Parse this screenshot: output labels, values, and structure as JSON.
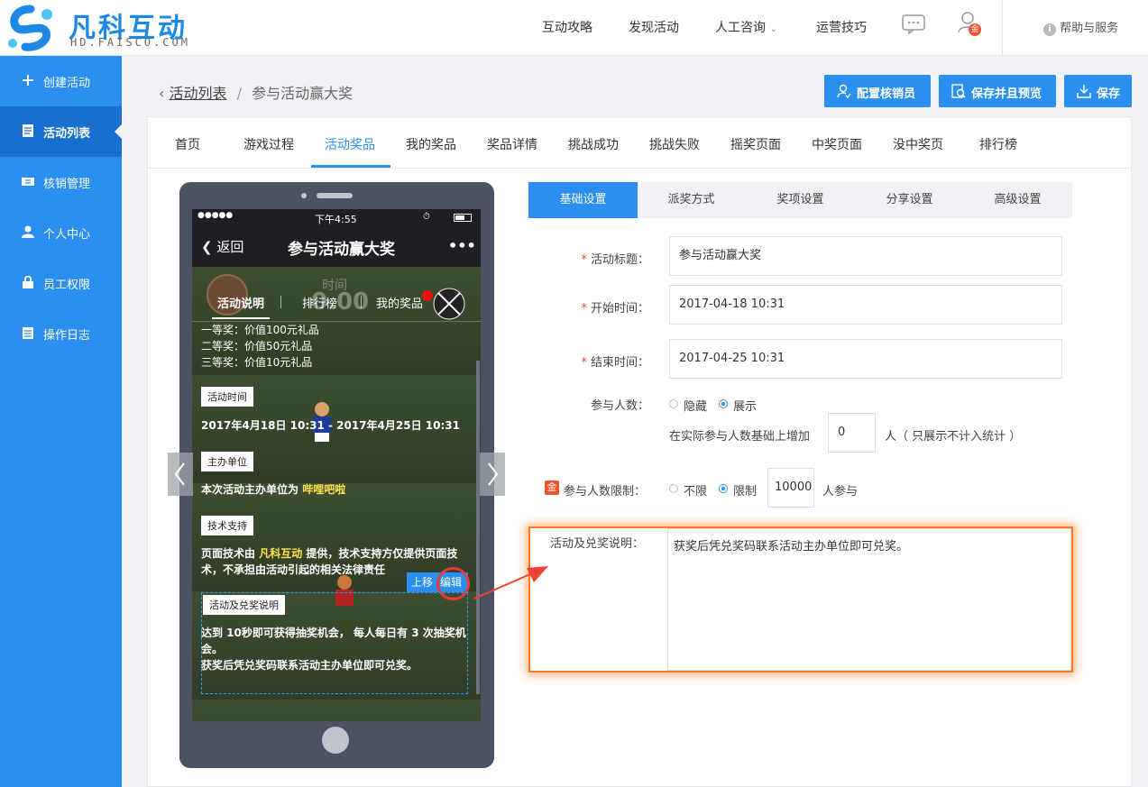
{
  "brand": {
    "name": "凡科互动",
    "sub": "HD.FAISCO.COM"
  },
  "topnav": {
    "items": [
      "互动攻略",
      "发现活动",
      "人工咨询",
      "运营技巧"
    ],
    "badge": "金",
    "help": "帮助与服务"
  },
  "sidebar": {
    "items": [
      {
        "label": "创建活动",
        "icon": "plus-icon"
      },
      {
        "label": "活动列表",
        "icon": "list-icon"
      },
      {
        "label": "核销管理",
        "icon": "ticket-icon"
      },
      {
        "label": "个人中心",
        "icon": "user-icon"
      },
      {
        "label": "员工权限",
        "icon": "lock-icon"
      },
      {
        "label": "操作日志",
        "icon": "log-icon"
      }
    ]
  },
  "breadcrumb": {
    "back": "活动列表",
    "sep": "/",
    "current": "参与活动赢大奖"
  },
  "actions": {
    "config": "配置核销员",
    "save_preview": "保存并且预览",
    "save": "保存"
  },
  "tabs": [
    "首页",
    "游戏过程",
    "活动奖品",
    "我的奖品",
    "奖品详情",
    "挑战成功",
    "挑战失败",
    "摇奖页面",
    "中奖页面",
    "没中奖页",
    "排行榜"
  ],
  "phone": {
    "status": {
      "signal": "●●●●●",
      "time": "下午4:55"
    },
    "nav": {
      "back": "返回",
      "title": "参与活动赢大奖",
      "more": "•••"
    },
    "tabs": [
      "活动说明",
      "排行榜",
      "我的奖品"
    ],
    "bg_label": "时间",
    "bg_score": "0.00",
    "prizes": [
      "一等奖：价值100元礼品",
      "二等奖：价值50元礼品",
      "三等奖：价值10元礼品"
    ],
    "time_tag": "活动时间",
    "time_text": "2017年4月18日 10:31 - 2017年4月25日 10:31",
    "host_tag": "主办单位",
    "host_text": "本次活动主办单位为",
    "host_name": "哔哩吧啦",
    "tech_tag": "技术支持",
    "tech_text_a": "页面技术由",
    "tech_brand": "凡科互动",
    "tech_text_b": "提供，技术支持方仅提供页面技术，不承担由活动引起的相关法律责任",
    "move_up": "上移",
    "edit": "编辑",
    "desc_tag": "活动及兑奖说明",
    "desc_text": "达到 10秒即可获得抽奖机会， 每人每日有 3 次抽奖机会。",
    "desc_text2": "获奖后凭兑奖码联系活动主办单位即可兑奖。"
  },
  "settings": {
    "tabs": [
      "基础设置",
      "派奖方式",
      "奖项设置",
      "分享设置",
      "高级设置"
    ],
    "title_label": "活动标题：",
    "title_value": "参与活动赢大奖",
    "start_label": "开始时间：",
    "start_value": "2017-04-18 10:31",
    "end_label": "结束时间：",
    "end_value": "2017-04-25 10:31",
    "people_label": "参与人数：",
    "people_opt_hide": "隐藏",
    "people_opt_show": "展示",
    "people_extra_a": "在实际参与人数基础上增加",
    "people_extra_value": "0",
    "people_extra_b": "人（ 只展示不计入统计 ）",
    "limit_badge": "金",
    "limit_label": "参与人数限制：",
    "limit_opt_none": "不限",
    "limit_opt_limit": "限制",
    "limit_value": "10000",
    "limit_suffix": "人参与",
    "desc_label": "活动及兑奖说明：",
    "desc_value": "获奖后凭兑奖码联系活动主办单位即可兑奖。"
  },
  "colors": {
    "primary": "#2a8ff0",
    "sidebar": "#2a8ff0",
    "highlight": "#ff7a1a",
    "arrow": "#f04134"
  }
}
